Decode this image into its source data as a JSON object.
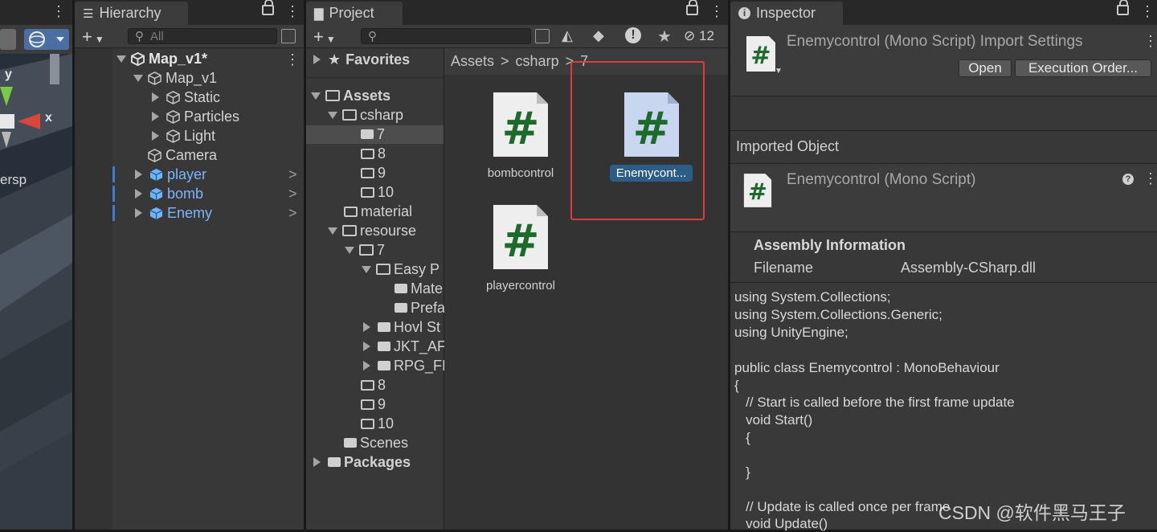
{
  "scene": {
    "axis_y": "y",
    "axis_x": "x",
    "persp_label": "ersp"
  },
  "hierarchy": {
    "tab_label": "Hierarchy",
    "search_placeholder": "All",
    "scene_name": "Map_v1*",
    "items": [
      {
        "label": "Map_v1"
      },
      {
        "label": "Static"
      },
      {
        "label": "Particles"
      },
      {
        "label": "Light"
      },
      {
        "label": "Camera"
      },
      {
        "label": "player"
      },
      {
        "label": "bomb"
      },
      {
        "label": "Enemy"
      }
    ]
  },
  "project": {
    "tab_label": "Project",
    "hidden_count": "12",
    "favorites": "Favorites",
    "tree": [
      {
        "label": "Assets"
      },
      {
        "label": "csharp"
      },
      {
        "label": "7"
      },
      {
        "label": "8"
      },
      {
        "label": "9"
      },
      {
        "label": "10"
      },
      {
        "label": "material"
      },
      {
        "label": "resourse"
      },
      {
        "label": "7"
      },
      {
        "label": "Easy P"
      },
      {
        "label": "Mate"
      },
      {
        "label": "Prefa"
      },
      {
        "label": "Hovl St"
      },
      {
        "label": "JKT_AF"
      },
      {
        "label": "RPG_FI"
      },
      {
        "label": "8"
      },
      {
        "label": "9"
      },
      {
        "label": "10"
      },
      {
        "label": "Scenes"
      },
      {
        "label": "Packages"
      }
    ],
    "breadcrumb": [
      "Assets",
      "csharp",
      "7"
    ],
    "files": [
      {
        "label": "bombcontrol"
      },
      {
        "label": "Enemycont..."
      },
      {
        "label": "playercontrol"
      }
    ],
    "icon_glyph": "#"
  },
  "inspector": {
    "tab_label": "Inspector",
    "title": "Enemycontrol (Mono Script) Import Settings",
    "open_button": "Open",
    "exec_order_button": "Execution Order...",
    "imported_object_label": "Imported Object",
    "object_title": "Enemycontrol (Mono Script)",
    "assembly_header": "Assembly Information",
    "filename_label": "Filename",
    "filename_value": "Assembly-CSharp.dll",
    "code_lines": [
      "using System.Collections;",
      "using System.Collections.Generic;",
      "using UnityEngine;",
      "",
      "public class Enemycontrol : MonoBehaviour",
      "{",
      "   // Start is called before the first frame update",
      "   void Start()",
      "   {",
      "",
      "   }",
      "",
      "   // Update is called once per frame",
      "   void Update()"
    ]
  },
  "watermark": "CSDN @软件黑马王子",
  "colors": {
    "panel_bg": "#383838",
    "selection_blue": "#2c5d87",
    "prefab_blue": "#7bb4ff",
    "highlight_red": "#e03a3a",
    "script_green": "#1d6b2c"
  }
}
